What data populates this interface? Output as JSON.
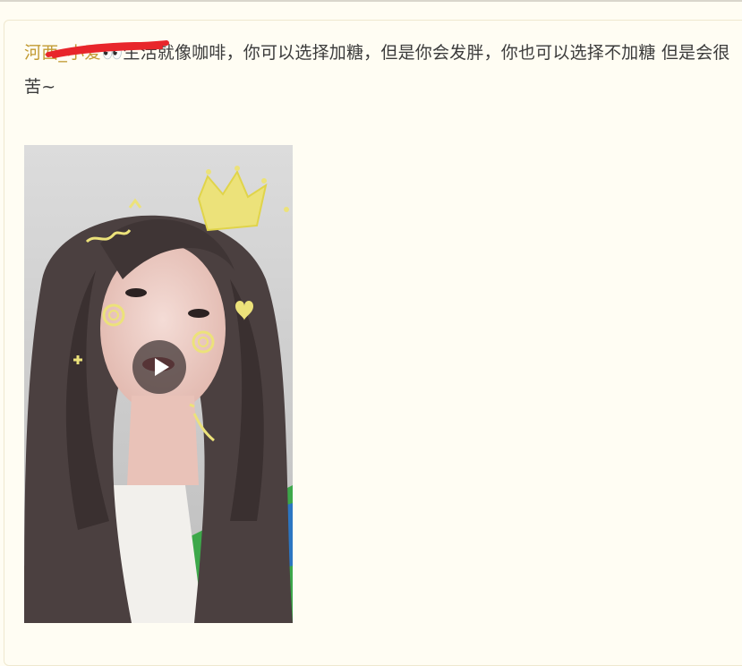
{
  "post": {
    "author": "河西_小爱",
    "author_suffix_emoji": "👀",
    "text": "生活就像咖啡，你可以选择加糖，但是你会发胖，你也可以选择不加糖 但是会很苦~"
  },
  "video": {
    "play_icon": "play-icon",
    "overlay_stickers": [
      "crown-doodle",
      "heart-doodle",
      "swirl-doodle",
      "sparkle-doodle"
    ]
  },
  "colors": {
    "background": "#fffdf3",
    "author_link": "#c29b33",
    "body_text": "#3b3b3b",
    "redaction": "#e8262b",
    "sticker": "#ece27a"
  }
}
